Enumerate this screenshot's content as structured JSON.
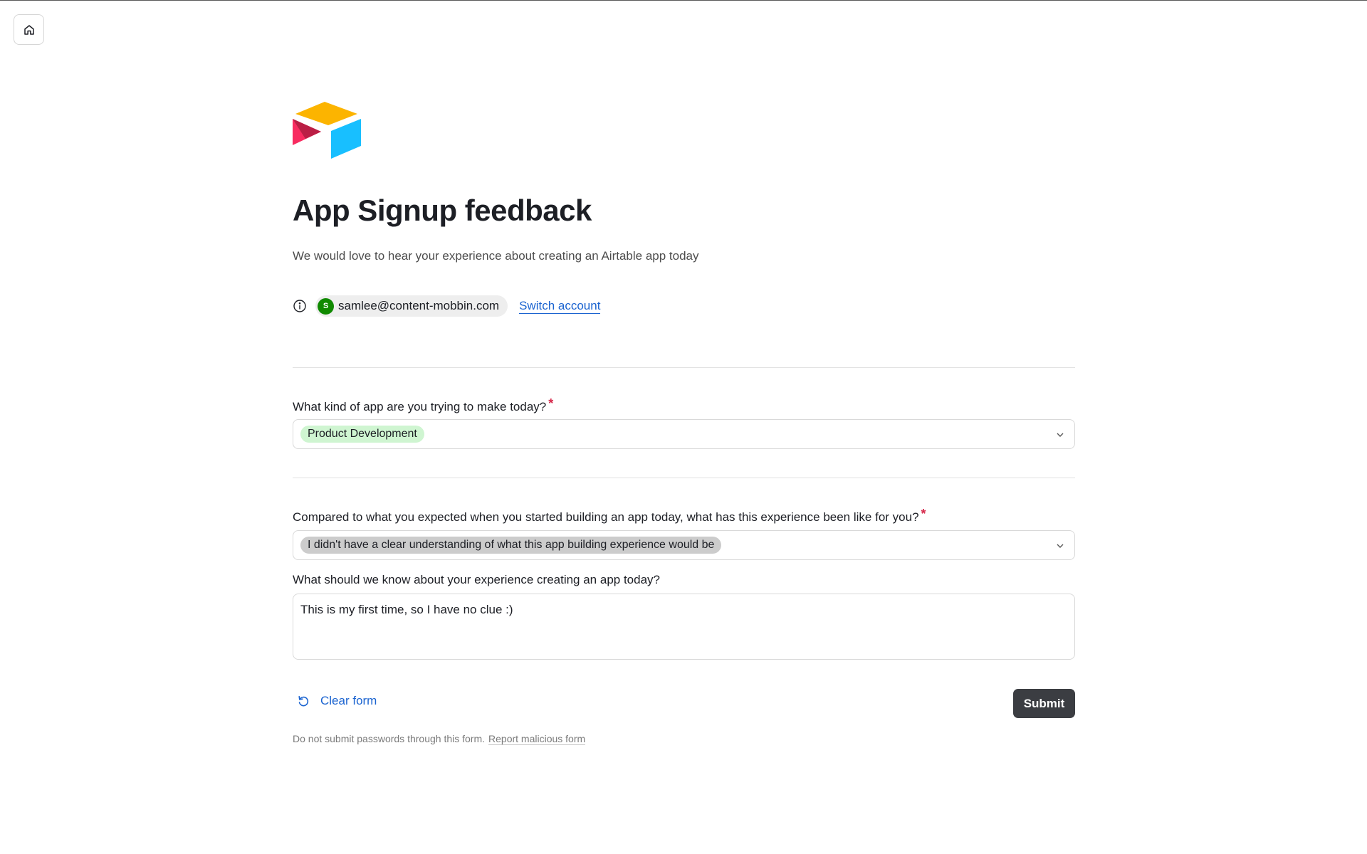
{
  "nav": {
    "home_icon": "home-icon"
  },
  "form": {
    "title": "App Signup feedback",
    "description": "We would love to hear your experience about creating an Airtable app today",
    "account": {
      "avatar_initial": "S",
      "email": "samlee@content-mobbin.com",
      "switch_label": "Switch account"
    },
    "questions": [
      {
        "label": "What kind of app are you trying to make today?",
        "required_mark": "*",
        "selected": "Product Development"
      },
      {
        "label": "Compared to what you expected when you started building an app today, what has this experience been like for you?",
        "required_mark": "*",
        "selected": "I didn't have a clear understanding of what this app building experience would be"
      },
      {
        "label": "What should we know about your experience creating an app today?",
        "value": "This is my first time, so I have no clue :)"
      }
    ],
    "clear_label": "Clear form",
    "submit_label": "Submit",
    "footer": {
      "notice": "Do not submit passwords through this form.",
      "report_label": "Report malicious form"
    }
  },
  "colors": {
    "accent": "#1a63d0",
    "required": "#d6284a",
    "pill_green": "#cff5d1",
    "pill_gray": "#cccccc",
    "submit_bg": "#3b3d42",
    "avatar_bg": "#108a00"
  }
}
